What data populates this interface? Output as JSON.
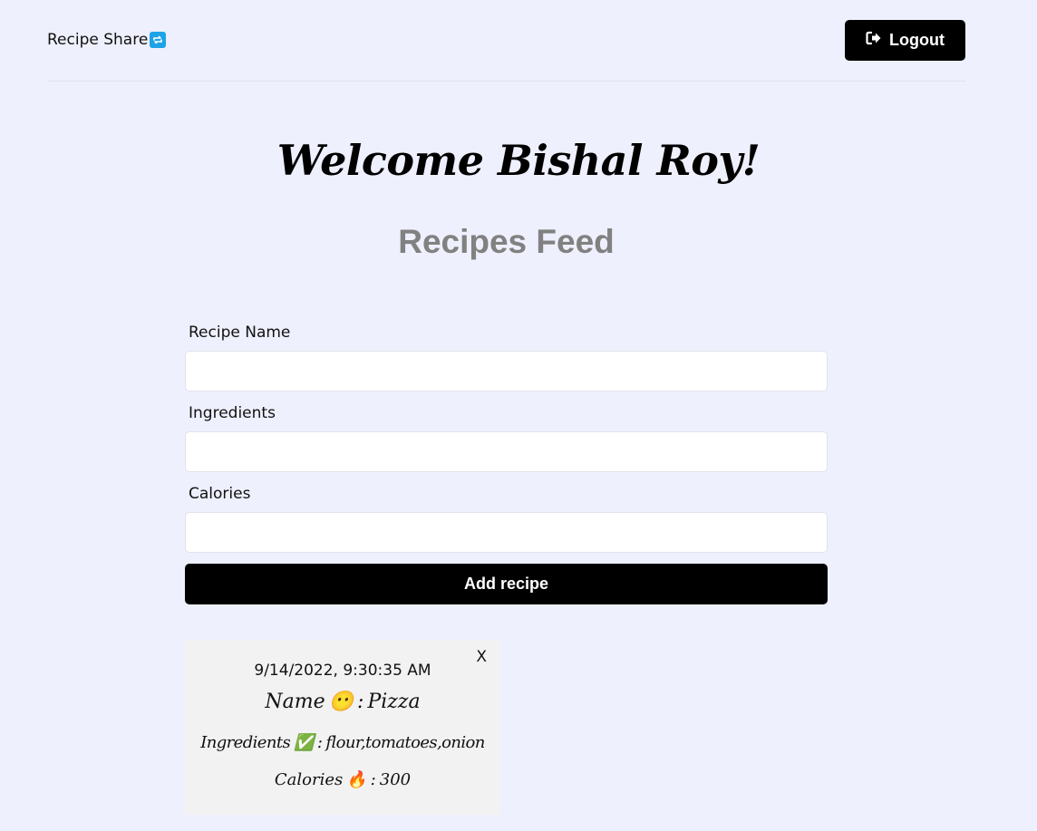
{
  "header": {
    "brand": "Recipe Share",
    "brand_icon": "repeat-icon",
    "logout_label": "Logout",
    "logout_icon": "sign-out-icon"
  },
  "welcome": "Welcome Bishal Roy!",
  "feed_title": "Recipes Feed",
  "form": {
    "recipe_name_label": "Recipe Name",
    "recipe_name_value": "",
    "ingredients_label": "Ingredients",
    "ingredients_value": "",
    "calories_label": "Calories",
    "calories_value": "",
    "add_label": "Add recipe"
  },
  "recipes": [
    {
      "timestamp": "9/14/2022, 9:30:35 AM",
      "name_label": "Name",
      "name_emoji": "😶",
      "name": "Pizza",
      "ingredients_label": "Ingredients",
      "ingredients_emoji": "✅",
      "ingredients": "flour,tomatoes,onion",
      "calories_label": "Calories",
      "calories_emoji": "🔥",
      "calories": "300",
      "separator": ":",
      "close_label": "X"
    }
  ],
  "colors": {
    "background": "#eef0fd",
    "accent": "#000000",
    "brand_icon": "#1ea3e6",
    "feed_title": "#818181",
    "card": "#f2f2f2"
  }
}
